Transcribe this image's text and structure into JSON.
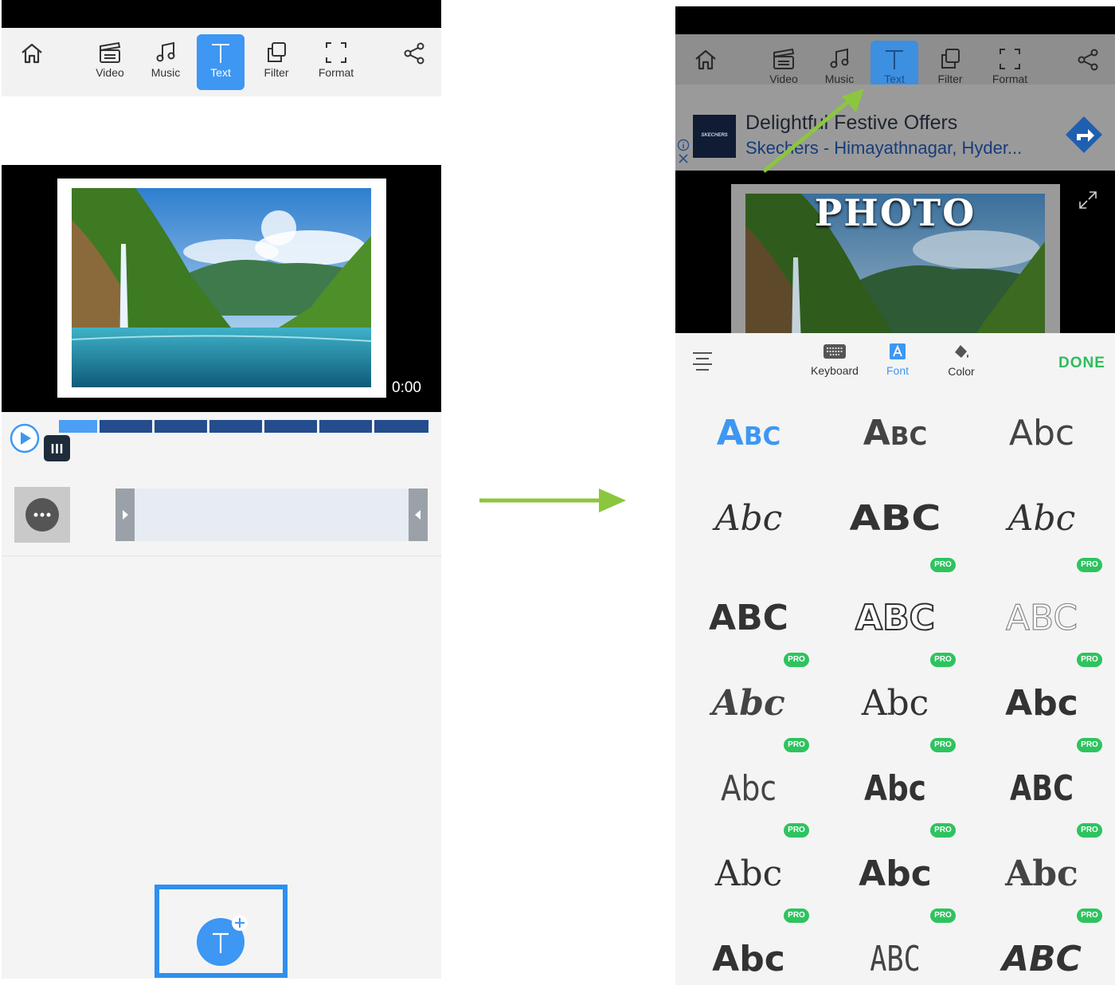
{
  "left_screen": {
    "toolbar": {
      "video_label": "Video",
      "music_label": "Music",
      "text_label": "Text",
      "filter_label": "Filter",
      "format_label": "Format"
    },
    "preview": {
      "timecode": "0:00"
    }
  },
  "right_screen": {
    "toolbar": {
      "video_label": "Video",
      "music_label": "Music",
      "text_label": "Text",
      "filter_label": "Filter",
      "format_label": "Format"
    },
    "ad": {
      "title": "Delightful Festive Offers",
      "subtitle": "Skechers - Himayathnagar, Hyder...",
      "brand": "SKECHERS"
    },
    "preview": {
      "overlay_text": "PHOTO"
    },
    "edit_bar": {
      "keyboard_label": "Keyboard",
      "font_label": "Font",
      "color_label": "Color",
      "done_label": "DONE"
    },
    "fonts": {
      "pro_badge": "PRO",
      "samples": [
        "Abc",
        "Abc",
        "Abc",
        "Abc",
        "ABC",
        "Abc",
        "ABC",
        "ABC",
        "ABC",
        "Abc",
        "Abc",
        "Abc",
        "Abc",
        "Abc",
        "ABC",
        "Abc",
        "Abc",
        "Abc",
        "Abc",
        "ABC",
        "ABC"
      ],
      "pro_flags": [
        false,
        false,
        false,
        false,
        false,
        false,
        false,
        true,
        true,
        true,
        true,
        true,
        true,
        true,
        true,
        true,
        true,
        true,
        true,
        true,
        true
      ]
    }
  },
  "colors": {
    "accent": "#3d97f3",
    "done": "#2dbd5b",
    "arrow": "#8cc63f",
    "highlight": "#2f8ff0"
  }
}
